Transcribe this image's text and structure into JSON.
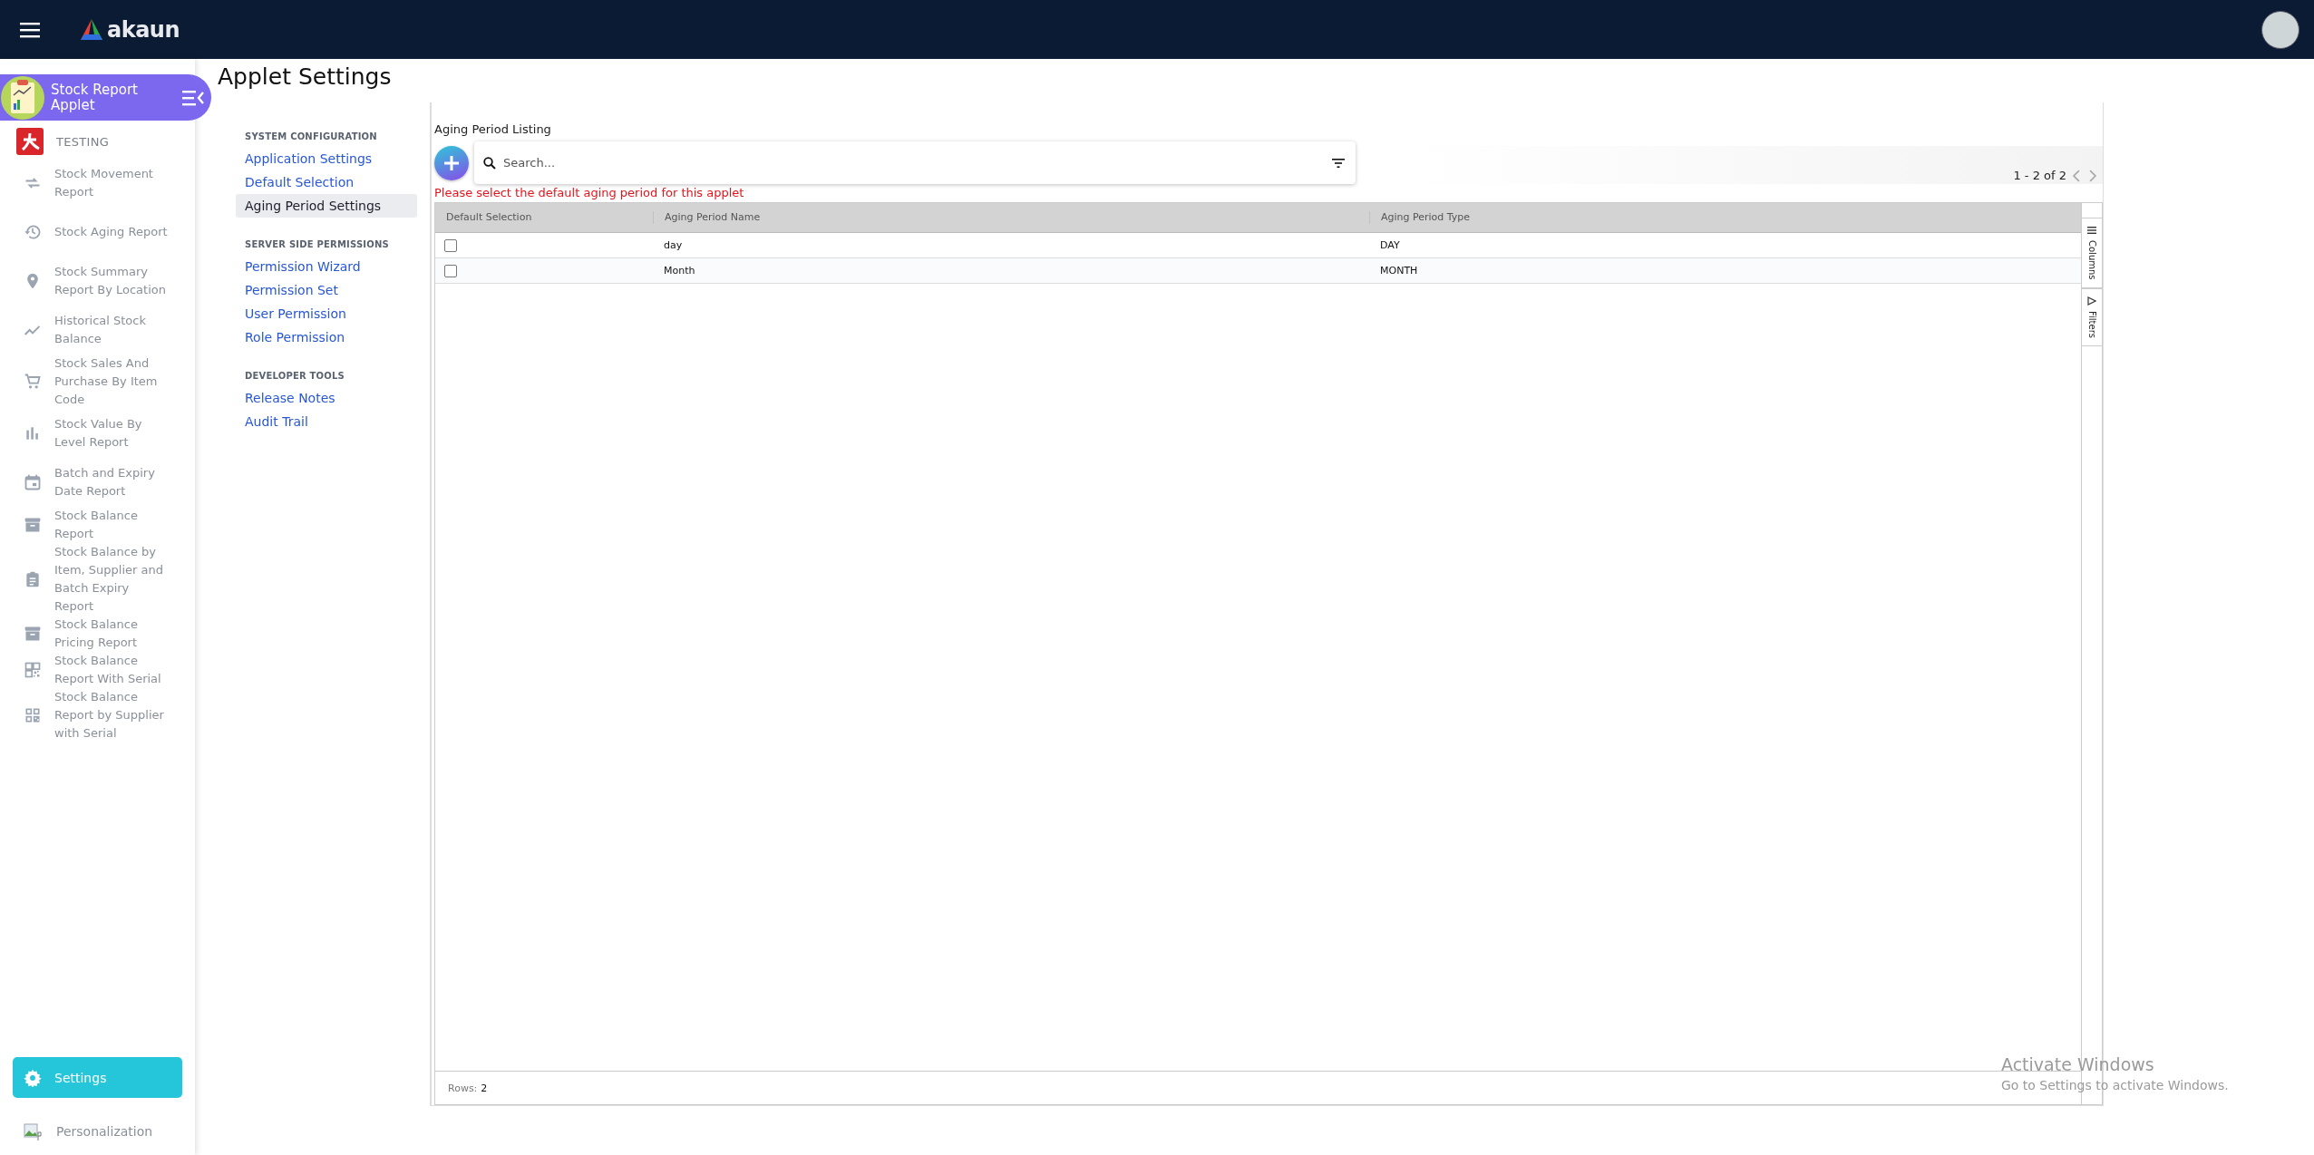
{
  "header": {
    "logo_text": "akaun"
  },
  "applet": {
    "name": "Stock Report Applet"
  },
  "sidebar": {
    "group": "TESTING",
    "items": [
      {
        "label": "Stock Movement Report"
      },
      {
        "label": "Stock Aging Report"
      },
      {
        "label": "Stock Summary Report By Location"
      },
      {
        "label": "Historical Stock Balance"
      },
      {
        "label": "Stock Sales And Purchase By Item Code"
      },
      {
        "label": "Stock Value By Level Report"
      },
      {
        "label": "Batch and Expiry Date Report"
      },
      {
        "label": "Stock Balance Report"
      },
      {
        "label": "Stock Balance by Item, Supplier and Batch Expiry Report"
      },
      {
        "label": "Stock Balance Pricing Report"
      },
      {
        "label": "Stock Balance Report With Serial"
      },
      {
        "label": "Stock Balance Report by Supplier with Serial"
      }
    ],
    "footer_items": [
      {
        "label": "Settings",
        "selected": true
      },
      {
        "label": "Personalization",
        "selected": false
      }
    ]
  },
  "page_title": "Applet Settings",
  "settings_nav": [
    {
      "heading": "SYSTEM CONFIGURATION",
      "items": [
        {
          "label": "Application Settings",
          "selected": false
        },
        {
          "label": "Default Selection",
          "selected": false
        },
        {
          "label": "Aging Period Settings",
          "selected": true
        }
      ]
    },
    {
      "heading": "SERVER SIDE PERMISSIONS",
      "items": [
        {
          "label": "Permission Wizard",
          "selected": false
        },
        {
          "label": "Permission Set",
          "selected": false
        },
        {
          "label": "User Permission",
          "selected": false
        },
        {
          "label": "Role Permission",
          "selected": false
        }
      ]
    },
    {
      "heading": "DEVELOPER TOOLS",
      "items": [
        {
          "label": "Release Notes",
          "selected": false
        },
        {
          "label": "Audit Trail",
          "selected": false
        }
      ]
    }
  ],
  "listing": {
    "title": "Aging Period Listing",
    "search": {
      "placeholder": "Search..."
    },
    "warning": "Please select the default aging period for this applet",
    "pagination": "1 - 2 of 2",
    "columns": [
      "Default Selection",
      "Aging Period Name",
      "Aging Period Type"
    ],
    "rows": [
      {
        "checked": false,
        "name": "day",
        "type": "DAY"
      },
      {
        "checked": false,
        "name": "Month",
        "type": "MONTH"
      }
    ],
    "side_tabs": [
      "Columns",
      "Filters"
    ],
    "rows_label": "Rows:",
    "rows_count": "2"
  },
  "os_notice": {
    "title": "Activate Windows",
    "text": "Go to Settings to activate Windows."
  }
}
